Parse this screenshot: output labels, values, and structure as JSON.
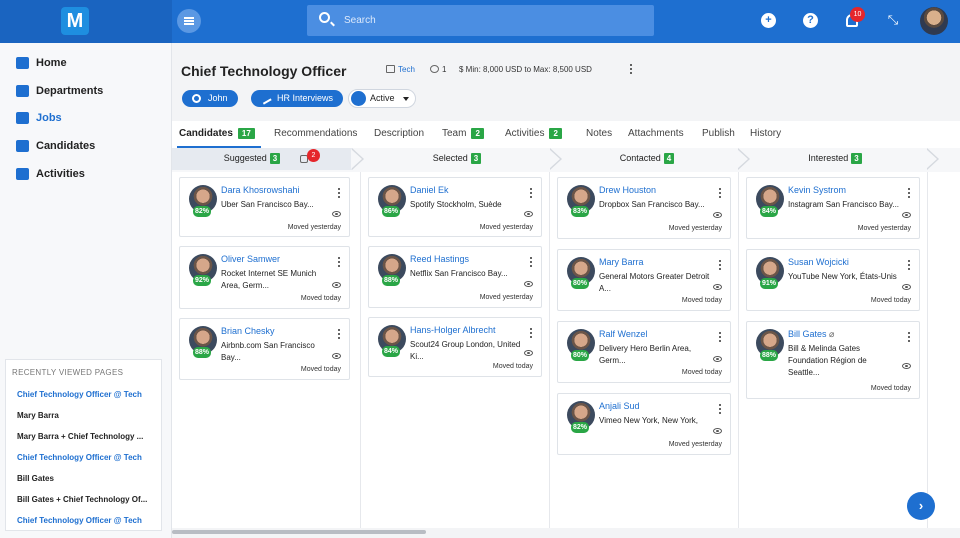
{
  "app": {
    "logo_letter": "M"
  },
  "search": {
    "placeholder": "Search"
  },
  "topbar": {
    "notifications_count": "10",
    "add_icon": "+",
    "help_icon": "?",
    "expand_icon": "⤡"
  },
  "sidebar": {
    "items": [
      {
        "label": "Home",
        "icon": "home-icon"
      },
      {
        "label": "Departments",
        "icon": "bank-icon"
      },
      {
        "label": "Jobs",
        "icon": "briefcase-icon",
        "active": true
      },
      {
        "label": "Candidates",
        "icon": "people-icon"
      },
      {
        "label": "Activities",
        "icon": "calendar-star-icon"
      }
    ],
    "recent": {
      "title": "RECENTLY VIEWED PAGES",
      "items": [
        {
          "label": "Chief Technology Officer @ Tech",
          "link": true
        },
        {
          "label": "Mary Barra",
          "link": false
        },
        {
          "label": "Mary Barra + Chief Technology ...",
          "link": false
        },
        {
          "label": "Chief Technology Officer @ Tech",
          "link": true
        },
        {
          "label": "Bill Gates",
          "link": false
        },
        {
          "label": "Bill Gates + Chief Technology Of...",
          "link": false
        },
        {
          "label": "Chief Technology Officer @ Tech",
          "link": true
        }
      ]
    }
  },
  "job": {
    "title": "Chief Technology Officer",
    "department": "Tech",
    "openings": "1",
    "salary": "Min: 8,000 USD to Max: 8,500 USD",
    "owner": "John",
    "stage_type": "HR Interviews",
    "status": "Active"
  },
  "tabs": [
    {
      "label": "Candidates",
      "count": "17",
      "active": true
    },
    {
      "label": "Recommendations"
    },
    {
      "label": "Description"
    },
    {
      "label": "Team",
      "count": "2"
    },
    {
      "label": "Activities",
      "count": "2"
    },
    {
      "label": "Notes"
    },
    {
      "label": "Attachments"
    },
    {
      "label": "Publish"
    },
    {
      "label": "History"
    }
  ],
  "pipeline": {
    "suggested_badge": "2",
    "stages": [
      {
        "label": "Suggested",
        "count": "3"
      },
      {
        "label": "Selected",
        "count": "3"
      },
      {
        "label": "Contacted",
        "count": "4"
      },
      {
        "label": "Interested",
        "count": "3"
      }
    ],
    "columns": [
      [
        {
          "name": "Dara Khosrowshahi",
          "company": "Uber San Francisco Bay...",
          "score": "82%",
          "moved": "Moved yesterday"
        },
        {
          "name": "Oliver Samwer",
          "company": "Rocket Internet SE Munich Area, Germ...",
          "score": "92%",
          "moved": "Moved today"
        },
        {
          "name": "Brian Chesky",
          "company": "Airbnb.com San Francisco Bay...",
          "score": "88%",
          "moved": "Moved today"
        }
      ],
      [
        {
          "name": "Daniel Ek",
          "company": "Spotify Stockholm, Suède",
          "score": "86%",
          "moved": "Moved yesterday"
        },
        {
          "name": "Reed Hastings",
          "company": "Netflix San Francisco Bay...",
          "score": "88%",
          "moved": "Moved yesterday"
        },
        {
          "name": "Hans-Holger Albrecht",
          "company": "Scout24 Group London, United Ki...",
          "score": "84%",
          "moved": "Moved today"
        }
      ],
      [
        {
          "name": "Drew Houston",
          "company": "Dropbox San Francisco Bay...",
          "score": "83%",
          "moved": "Moved yesterday"
        },
        {
          "name": "Mary Barra",
          "company": "General Motors Greater Detroit A...",
          "score": "80%",
          "moved": "Moved today"
        },
        {
          "name": "Ralf Wenzel",
          "company": "Delivery Hero Berlin Area, Germ...",
          "score": "80%",
          "moved": "Moved today"
        },
        {
          "name": "Anjali Sud",
          "company": "Vimeo New York, New York,",
          "score": "82%",
          "moved": "Moved yesterday"
        }
      ],
      [
        {
          "name": "Kevin Systrom",
          "company": "Instagram San Francisco Bay...",
          "score": "84%",
          "moved": "Moved yesterday"
        },
        {
          "name": "Susan Wojcicki",
          "company": "YouTube New York, États-Unis",
          "score": "91%",
          "moved": "Moved today"
        },
        {
          "name": "Bill Gates",
          "company": "Bill & Melinda Gates Foundation Région de Seattle...",
          "score": "88%",
          "moved": "Moved today",
          "attachment": true
        }
      ]
    ]
  },
  "fab": {
    "icon": "›"
  }
}
